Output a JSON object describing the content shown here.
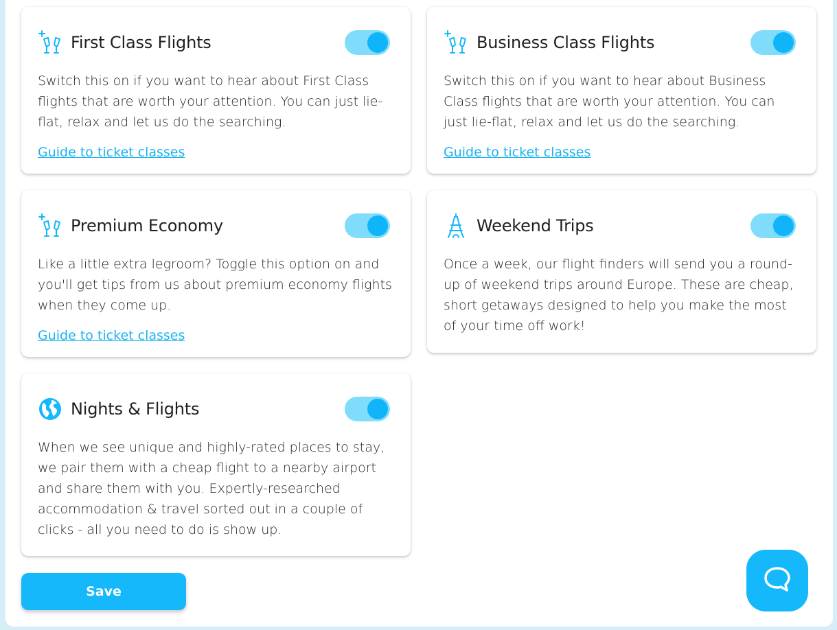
{
  "colors": {
    "accent": "#14b8fb",
    "toggle_track": "#7fdcfb",
    "link": "#1ab3ef"
  },
  "cards": [
    {
      "icon": "champagne-glasses-icon",
      "title": "First Class Flights",
      "enabled": true,
      "description": "Switch this on if you want to hear about First Class flights that are worth your attention. You can just lie-flat, relax and let us do the searching.",
      "link": "Guide to ticket classes"
    },
    {
      "icon": "champagne-glasses-icon",
      "title": "Business Class Flights",
      "enabled": true,
      "description": "Switch this on if you want to hear about Business Class flights that are worth your attention. You can just lie-flat, relax and let us do the searching.",
      "link": "Guide to ticket classes"
    },
    {
      "icon": "champagne-glasses-icon",
      "title": "Premium Economy",
      "enabled": true,
      "description": "Like a little extra legroom? Toggle this option on and you'll get tips from us about premium economy flights when they come up.",
      "link": "Guide to ticket classes"
    },
    {
      "icon": "eiffel-tower-icon",
      "title": "Weekend Trips",
      "enabled": true,
      "description": "Once a week, our flight finders will send you a round-up of weekend trips around Europe. These are cheap, short getaways designed to help you make the most of your time off work!"
    },
    {
      "icon": "globe-icon",
      "title": "Nights & Flights",
      "enabled": true,
      "description": "When we see unique and highly-rated places to stay, we pair them with a cheap flight to a nearby airport and share them with you. Expertly-researched accommodation & travel sorted out in a couple of clicks - all you need to do is show up."
    }
  ],
  "save_label": "Save",
  "chat_icon": "chat-bubble-icon"
}
